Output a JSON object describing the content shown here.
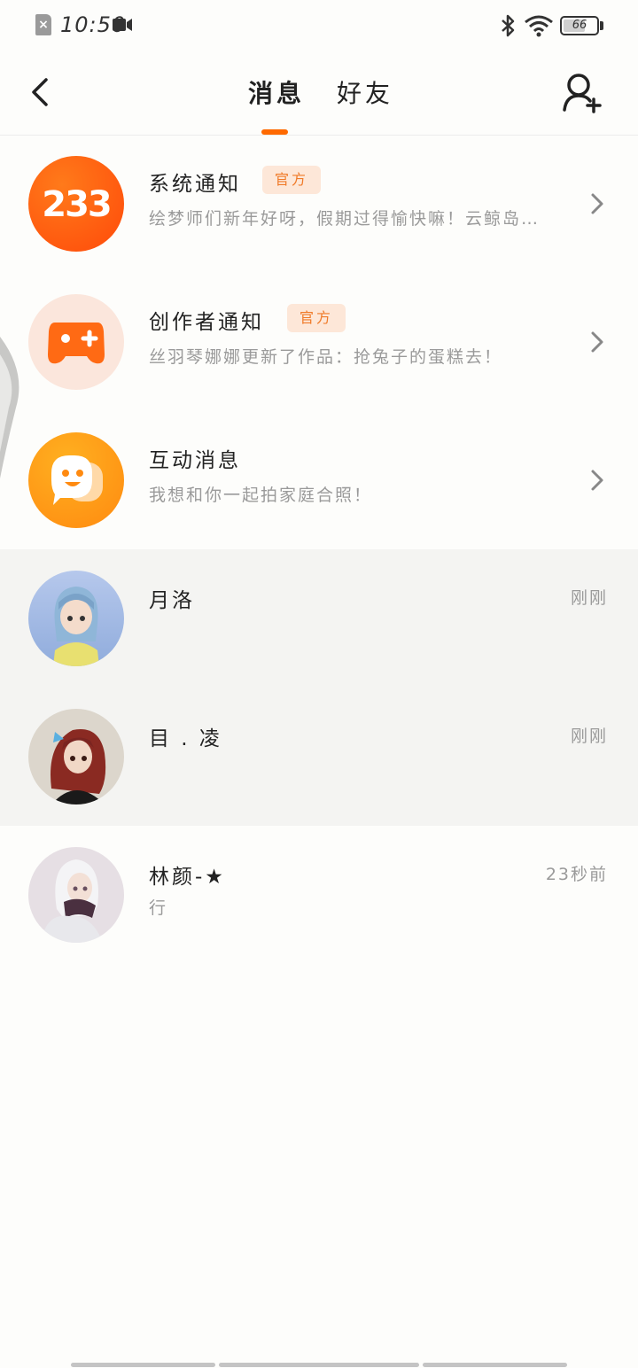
{
  "status_bar": {
    "time": "10:50",
    "battery": "66",
    "battery_level": 0.66,
    "icons": [
      "sim-error-icon",
      "screen-record-icon",
      "bluetooth-icon",
      "wifi-icon",
      "battery-icon"
    ]
  },
  "header": {
    "tabs": [
      {
        "label": "消息",
        "active": true
      },
      {
        "label": "好友",
        "active": false
      }
    ],
    "accent_color": "#ff6a00",
    "icons": [
      "back-icon",
      "add-friend-icon"
    ]
  },
  "conversations": [
    {
      "title": "系统通知",
      "badge": "官方",
      "preview": "绘梦师们新年好呀，假期过得愉快嘛！云鲸岛…",
      "avatar": "233-logo"
    },
    {
      "title": "创作者通知",
      "badge": "官方",
      "preview": "丝羽琴娜娜更新了作品：抢兔子的蛋糕去！",
      "avatar": "gamepad-icon"
    },
    {
      "title": "互动消息",
      "preview": "我想和你一起拍家庭合照！",
      "avatar": "chat-bubble-icon"
    },
    {
      "title": "月洛",
      "time": "刚刚",
      "avatar": "user-avatar"
    },
    {
      "title": "目 . 凌",
      "time": "刚刚",
      "avatar": "user-avatar"
    },
    {
      "title": "林颜-★",
      "time": "23秒前",
      "preview": "行",
      "avatar": "user-avatar"
    }
  ],
  "logo_text": "233"
}
